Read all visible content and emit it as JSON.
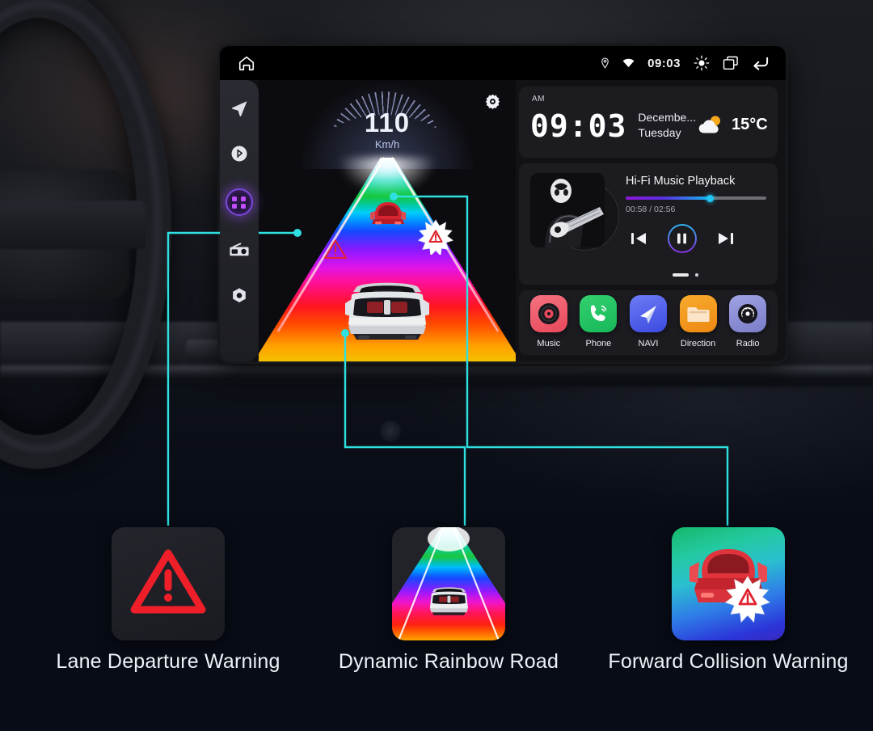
{
  "status_bar": {
    "home_icon": "home-icon",
    "location_icon": "location-pin-icon",
    "wifi_icon": "wifi-icon",
    "clock": "09:03",
    "brightness_icon": "brightness-icon",
    "recents_icon": "recents-icon",
    "back_icon": "back-icon"
  },
  "sidebar": {
    "items": [
      {
        "name": "navigation",
        "icon": "navigation-arrow-icon"
      },
      {
        "name": "bluetooth",
        "icon": "bluetooth-icon"
      },
      {
        "name": "apps",
        "icon": "apps-grid-icon",
        "active": true
      },
      {
        "name": "radio",
        "icon": "radio-icon"
      },
      {
        "name": "settings",
        "icon": "settings-gear-icon"
      }
    ]
  },
  "dashboard": {
    "speed_value": "110",
    "speed_unit": "Km/h",
    "settings_icon": "gear-icon",
    "warning_icon": "lane-departure-warning-triangle",
    "collision_burst_icon": "collision-burst-icon"
  },
  "clock_widget": {
    "ampm": "AM",
    "time": "09:03",
    "month": "Decembe...",
    "weekday": "Tuesday",
    "weather_icon": "partly-cloudy-icon",
    "temperature": "15°C"
  },
  "music": {
    "title": "Hi-Fi Music Playback",
    "elapsed_total": "00:58 / 02:56",
    "progress_percent": 60,
    "prev_icon": "previous-track-icon",
    "play_icon": "pause-icon",
    "next_icon": "next-track-icon",
    "album_art": "guitarist-photo"
  },
  "apps": [
    {
      "label": "Music",
      "icon": "vinyl-record-icon",
      "color": "#f2606d"
    },
    {
      "label": "Phone",
      "icon": "phone-handset-icon",
      "color": "#2bc964"
    },
    {
      "label": "NAVI",
      "icon": "paper-plane-icon",
      "color": "#4a6df0"
    },
    {
      "label": "Direction",
      "icon": "folder-icon",
      "color": "#f0971b"
    },
    {
      "label": "Radio",
      "icon": "radio-dial-icon",
      "color": "#8e90d6"
    }
  ],
  "features": [
    {
      "caption": "Lane Departure Warning",
      "icon": "red-warning-triangle-icon"
    },
    {
      "caption": "Dynamic Rainbow Road",
      "icon": "rainbow-road-thumbnail"
    },
    {
      "caption": "Forward Collision Warning",
      "icon": "red-car-collision-icon"
    }
  ],
  "colors": {
    "connector": "#2ee0e0",
    "accent_purple": "#8b2fe0",
    "accent_cyan": "#21c6f5",
    "warning_red": "#e8222e",
    "screen_bg": "#121216"
  }
}
